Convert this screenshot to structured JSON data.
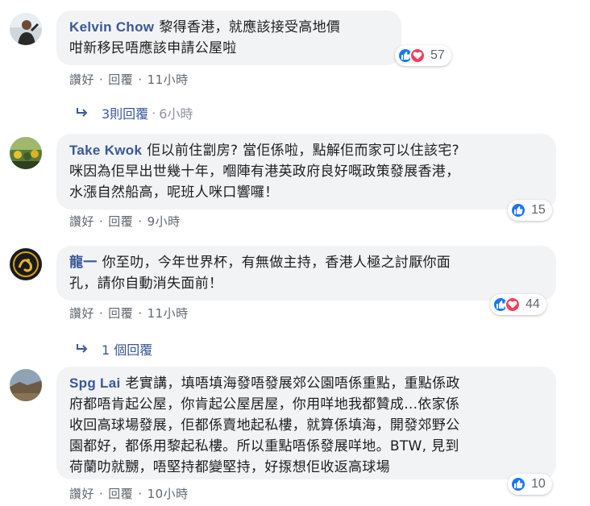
{
  "comments": [
    {
      "author": "Kelvin Chow",
      "lines": [
        "黎得香港，就應該接受高地價",
        "咁新移民唔應該申請公屋啦"
      ],
      "like_label": "讚好",
      "reply_label": "回覆",
      "time": "11小時",
      "reaction_count": "57",
      "reactions": [
        "like-icon",
        "love-icon"
      ]
    },
    {
      "author": "Take Kwok",
      "lines": [
        "佢以前住劏房? 當佢係啦，點解佢而家可以住該宅?",
        "咪因為佢早出世幾十年，嗰陣有港英政府良好嘅政策發展香港，",
        "水漲自然船高，呢班人咪口響囉！"
      ],
      "like_label": "讚好",
      "reply_label": "回覆",
      "time": "9小時",
      "reaction_count": "15",
      "reactions": [
        "like-icon"
      ]
    },
    {
      "author": "龍一",
      "lines": [
        "你至叻，今年世界杯，有無做主持，香港人極之討厭你面",
        "孔，請你自動消失面前！"
      ],
      "like_label": "讚好",
      "reply_label": "回覆",
      "time": "11小時",
      "reaction_count": "44",
      "reactions": [
        "like-icon",
        "love-icon"
      ]
    },
    {
      "author": "Spg Lai",
      "lines": [
        "老實講，填唔填海發唔發展郊公園唔係重點，重點係政",
        "府都唔肯起公屋，你肯起公屋居屋，你用咩地我都贊成...依家係",
        "收回高球場發展，佢都係賣地起私樓，就算係填海，開發郊野公",
        "園都好，都係用黎起私樓。所以重點唔係發展咩地。BTW, 見到",
        "荷蘭叻就嬲，唔堅持都變堅持，好揼想佢收返高球場"
      ],
      "like_label": "讚好",
      "reply_label": "回覆",
      "time": "10小時",
      "reaction_count": "10",
      "reactions": [
        "like-icon"
      ]
    }
  ],
  "reply_threads": [
    {
      "count_label": "3則回覆",
      "dot": "·",
      "time": "6小時"
    },
    {
      "count_label": "1 個回覆"
    }
  ],
  "colors": {
    "link": "#385898",
    "bubble": "#f2f3f5",
    "like": "#1877f2",
    "love": "#f33e58",
    "meta": "#606770"
  }
}
